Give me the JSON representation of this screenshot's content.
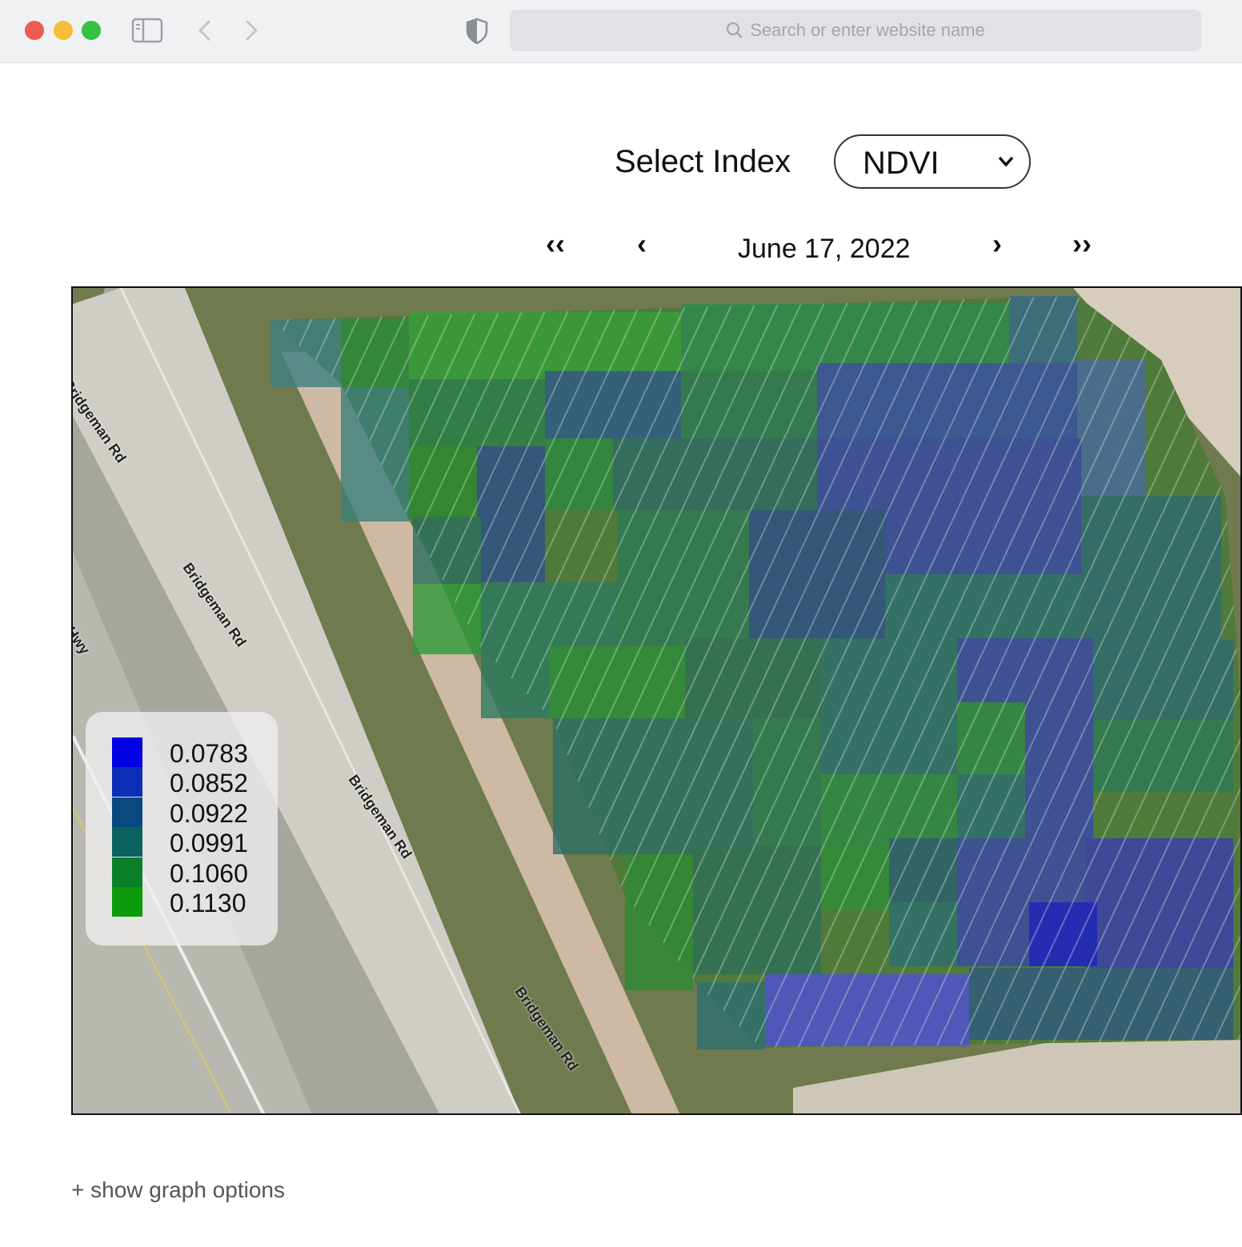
{
  "browser": {
    "address_placeholder": "Search or enter website name"
  },
  "controls": {
    "index_label": "Select Index",
    "index_selected": "NDVI",
    "nav_first": "‹‹",
    "nav_prev": "‹",
    "date": "June 17, 2022",
    "nav_next": "›",
    "nav_last": "››"
  },
  "map": {
    "road_labels": [
      "Bridgeman Rd",
      "Bridgeman Rd",
      "Bridgeman Rd",
      "Bridgeman Rd",
      "Hwy"
    ],
    "legend": [
      {
        "value": "0.0783",
        "color": "#0000e0"
      },
      {
        "value": "0.0852",
        "color": "#0a2fb5"
      },
      {
        "value": "0.0922",
        "color": "#0a4880"
      },
      {
        "value": "0.0991",
        "color": "#0b6060"
      },
      {
        "value": "0.1060",
        "color": "#0a7f2a"
      },
      {
        "value": "0.1130",
        "color": "#0a9a0a"
      }
    ]
  },
  "footer": {
    "graph_options": "+ show graph options"
  }
}
